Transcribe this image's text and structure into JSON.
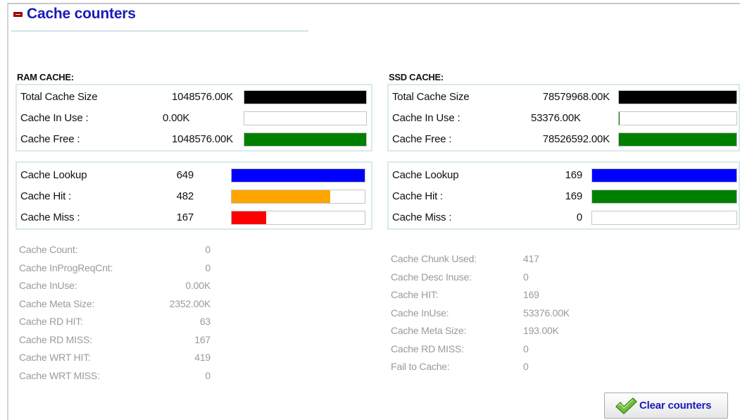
{
  "header": {
    "title": "Cache counters"
  },
  "ram": {
    "heading": "RAM CACHE:",
    "size_rows": [
      {
        "label": "Total Cache Size",
        "value": "1048576.00K",
        "fill_fraction": 1.0,
        "color": "#000000"
      },
      {
        "label": "Cache In Use :",
        "value": "0.00K",
        "fill_fraction": 0.0,
        "color": "#008000"
      },
      {
        "label": "Cache Free :",
        "value": "1048576.00K",
        "fill_fraction": 1.0,
        "color": "#008000"
      }
    ],
    "lookup_rows": [
      {
        "label": "Cache Lookup",
        "value": "649",
        "fill_fraction": 1.0,
        "color": "#0000ff"
      },
      {
        "label": "Cache Hit :",
        "value": "482",
        "fill_fraction": 0.743,
        "color": "#ffa500"
      },
      {
        "label": "Cache Miss :",
        "value": "167",
        "fill_fraction": 0.257,
        "color": "#ff0000"
      }
    ],
    "stats": [
      {
        "label": "Cache Count:",
        "value": "0"
      },
      {
        "label": "Cache InProgReqCnt:",
        "value": "0"
      },
      {
        "label": "Cache InUse:",
        "value": "0.00K"
      },
      {
        "label": "Cache Meta Size:",
        "value": "2352.00K"
      },
      {
        "label": "Cache RD HIT:",
        "value": "63"
      },
      {
        "label": "Cache RD MISS:",
        "value": "167"
      },
      {
        "label": "Cache WRT HIT:",
        "value": "419"
      },
      {
        "label": "Cache WRT MISS:",
        "value": "0"
      }
    ]
  },
  "ssd": {
    "heading": "SSD CACHE:",
    "size_rows": [
      {
        "label": "Total Cache Size",
        "value": "78579968.00K",
        "fill_fraction": 1.0,
        "color": "#000000"
      },
      {
        "label": "Cache In Use :",
        "value": "53376.00K",
        "fill_fraction": 0.0007,
        "color": "#008000"
      },
      {
        "label": "Cache Free :",
        "value": "78526592.00K",
        "fill_fraction": 0.9993,
        "color": "#008000"
      }
    ],
    "lookup_rows": [
      {
        "label": "Cache Lookup",
        "value": "169",
        "fill_fraction": 1.0,
        "color": "#0000ff"
      },
      {
        "label": "Cache Hit :",
        "value": "169",
        "fill_fraction": 1.0,
        "color": "#008000"
      },
      {
        "label": "Cache Miss :",
        "value": "0",
        "fill_fraction": 0.0,
        "color": "#ff0000"
      }
    ],
    "stats": [
      {
        "label": "Cache Chunk Used:",
        "value": "417"
      },
      {
        "label": "Cache Desc Inuse:",
        "value": "0"
      },
      {
        "label": "Cache HIT:",
        "value": "169"
      },
      {
        "label": "Cache InUse:",
        "value": "53376.00K"
      },
      {
        "label": "Cache Meta Size:",
        "value": "193.00K"
      },
      {
        "label": "Cache RD MISS:",
        "value": "0"
      },
      {
        "label": "Fail to Cache:",
        "value": "0"
      }
    ]
  },
  "actions": {
    "clear_label": "Clear counters",
    "clear_icon": "checkmark-icon",
    "accent_color": "#1a1ab8"
  }
}
